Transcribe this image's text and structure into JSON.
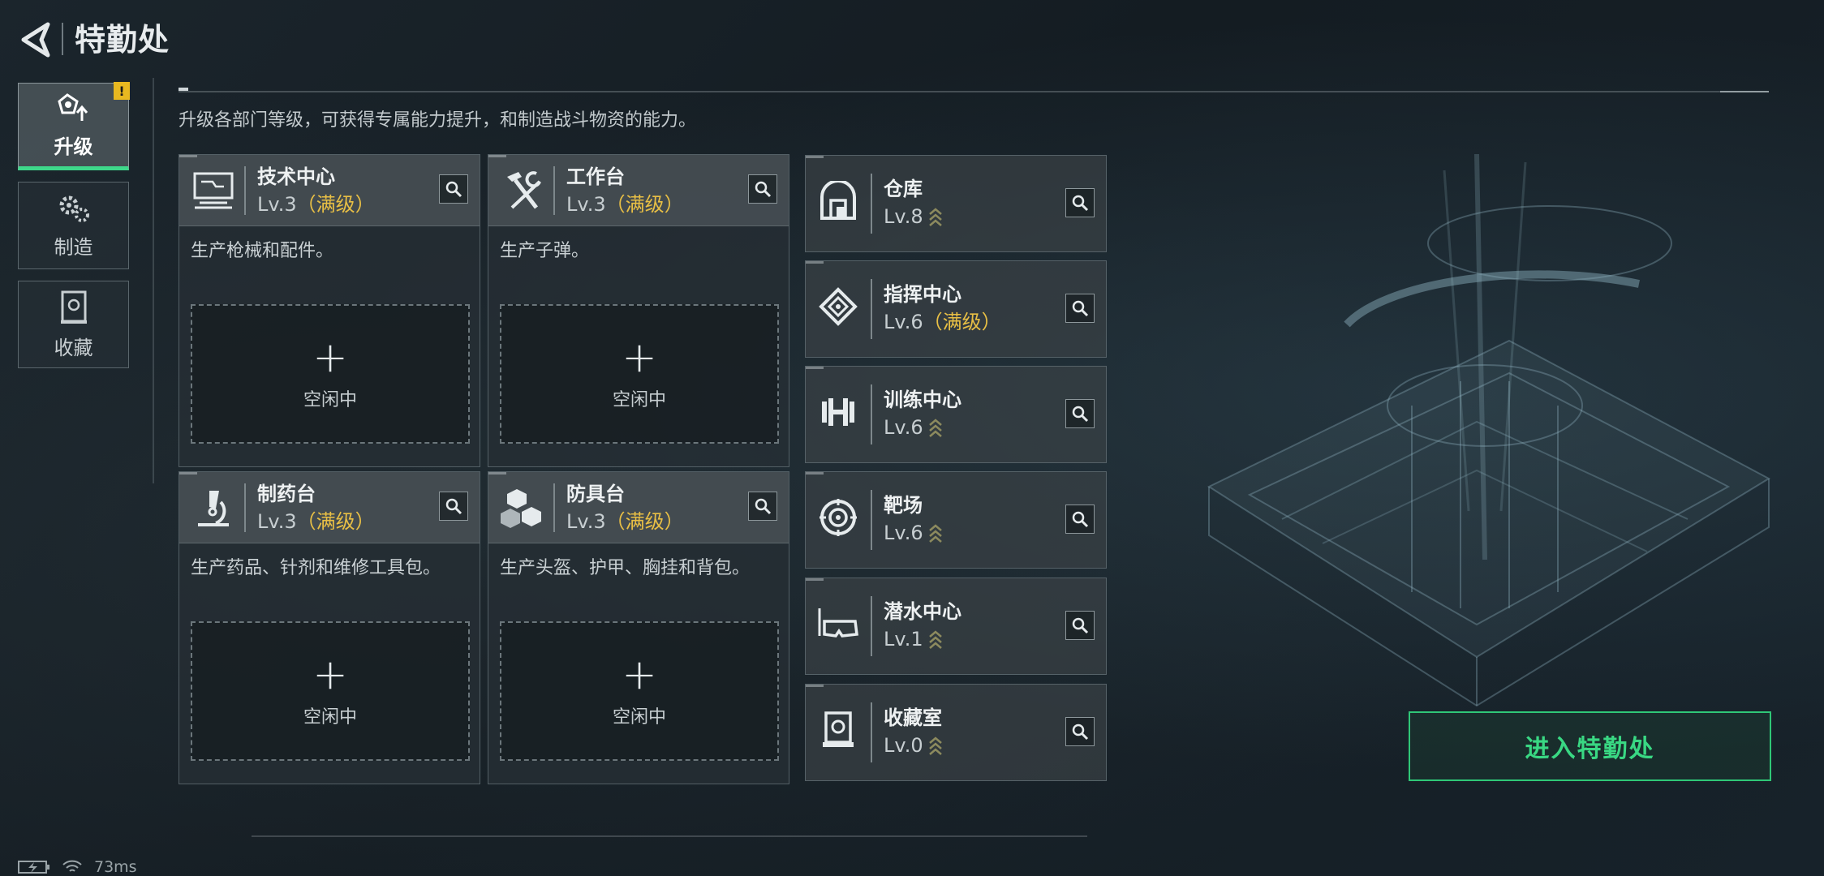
{
  "header": {
    "title": "特勤处"
  },
  "nav": {
    "items": [
      {
        "label": "升级",
        "active": true,
        "alert": "!"
      },
      {
        "label": "制造",
        "active": false
      },
      {
        "label": "收藏",
        "active": false
      }
    ]
  },
  "description": "升级各部门等级，可获得专属能力提升，和制造战斗物资的能力。",
  "departments": [
    {
      "name": "技术中心",
      "level": "Lv.3",
      "max_tag": "（满级）",
      "desc": "生产枪械和配件。",
      "slot_label": "空闲中"
    },
    {
      "name": "工作台",
      "level": "Lv.3",
      "max_tag": "（满级）",
      "desc": "生产子弹。",
      "slot_label": "空闲中"
    },
    {
      "name": "制药台",
      "level": "Lv.3",
      "max_tag": "（满级）",
      "desc": "生产药品、针剂和维修工具包。",
      "slot_label": "空闲中"
    },
    {
      "name": "防具台",
      "level": "Lv.3",
      "max_tag": "（满级）",
      "desc": "生产头盔、护甲、胸挂和背包。",
      "slot_label": "空闲中"
    }
  ],
  "facilities": [
    {
      "name": "仓库",
      "level": "Lv.8",
      "max_tag": "",
      "upgradable": true
    },
    {
      "name": "指挥中心",
      "level": "Lv.6",
      "max_tag": "（满级）",
      "upgradable": false
    },
    {
      "name": "训练中心",
      "level": "Lv.6",
      "max_tag": "",
      "upgradable": true
    },
    {
      "name": "靶场",
      "level": "Lv.6",
      "max_tag": "",
      "upgradable": true
    },
    {
      "name": "潜水中心",
      "level": "Lv.1",
      "max_tag": "",
      "upgradable": true
    },
    {
      "name": "收藏室",
      "level": "Lv.0",
      "max_tag": "",
      "upgradable": true
    }
  ],
  "cta": {
    "label": "进入特勤处"
  },
  "status": {
    "ping": "73ms"
  },
  "colors": {
    "accent": "#39d883",
    "max_level": "#e8bf45",
    "alert": "#e8b820"
  }
}
